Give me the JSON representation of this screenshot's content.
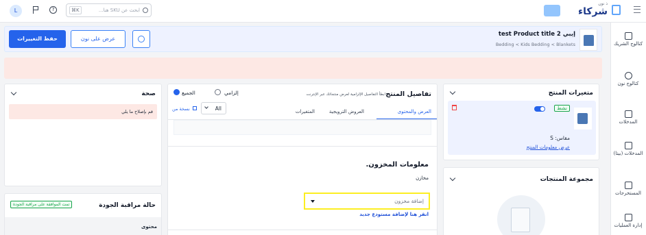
{
  "topbar": {
    "logo_small": "ذ نون",
    "logo_big": "شركاء",
    "search_placeholder": "ابحث عن SKU هنا...",
    "search_shortcut": "⌘K",
    "avatar_letter": "L",
    "brand_color": "#3b82f6",
    "accent_color": "#93c5fd"
  },
  "sidebar": {
    "items": [
      {
        "label": "كتالوج الشريك",
        "icon": "store-icon"
      },
      {
        "label": "كتالوج نون",
        "icon": "tag-icon"
      },
      {
        "label": "المدخلات",
        "icon": "inbox-icon"
      },
      {
        "label": "المدخلات (بيتا)",
        "icon": "inbox-beta-icon"
      },
      {
        "label": "المستخرجات",
        "icon": "export-icon"
      },
      {
        "label": "إدارة العمليات",
        "icon": "workflow-icon"
      }
    ]
  },
  "product": {
    "title": "إيبي test Product title 2",
    "breadcrumb": "Bedding < Kids Bedding < Blankets",
    "view_on_noon": "عرض على نون",
    "save_changes": "حفظ التغييرات"
  },
  "variants": {
    "title": "متغيرات المنتج",
    "status": "نشط",
    "size_label": "مقاس: S",
    "view_info": "عرض معلومات المنتج",
    "group_title": "مجموعة المنتجات"
  },
  "details": {
    "title": "تفاصيل المنتج",
    "subtitle": "ابطأ التفاصيل الإلزامية لعرض منتجاتك عبر الإنترنت",
    "filter_required": "إلزامي",
    "filter_all": "الجميع",
    "tabs": [
      "العرض والمحتوى",
      "العروض الترويجية",
      "المتغيرات"
    ],
    "copy_from": "نسخة من",
    "all_select": "All",
    "inventory_title": "معلومات المخزون.",
    "warehouse_label": "مخازن",
    "warehouse_placeholder": "إضافة مخزون",
    "new_warehouse_link": "انقر هنا لإضافة مستودع جديد"
  },
  "health": {
    "title": "صحة",
    "alert": "قم بإصلاح ما يلي"
  },
  "quality": {
    "title": "حالة مراقبة الجودة",
    "badge": "تمت الموافقة على مراقبة الجودة",
    "row_label": "محتوى"
  }
}
